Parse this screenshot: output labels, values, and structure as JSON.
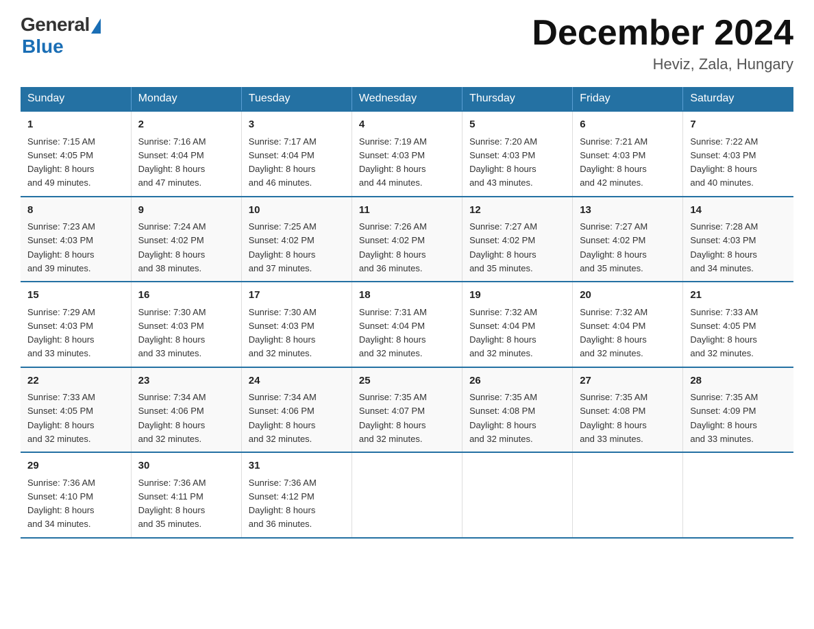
{
  "logo": {
    "general": "General",
    "blue": "Blue",
    "subtitle": "Blue"
  },
  "title": "December 2024",
  "location": "Heviz, Zala, Hungary",
  "days_of_week": [
    "Sunday",
    "Monday",
    "Tuesday",
    "Wednesday",
    "Thursday",
    "Friday",
    "Saturday"
  ],
  "weeks": [
    [
      {
        "day": "1",
        "sunrise": "7:15 AM",
        "sunset": "4:05 PM",
        "daylight": "8 hours and 49 minutes."
      },
      {
        "day": "2",
        "sunrise": "7:16 AM",
        "sunset": "4:04 PM",
        "daylight": "8 hours and 47 minutes."
      },
      {
        "day": "3",
        "sunrise": "7:17 AM",
        "sunset": "4:04 PM",
        "daylight": "8 hours and 46 minutes."
      },
      {
        "day": "4",
        "sunrise": "7:19 AM",
        "sunset": "4:03 PM",
        "daylight": "8 hours and 44 minutes."
      },
      {
        "day": "5",
        "sunrise": "7:20 AM",
        "sunset": "4:03 PM",
        "daylight": "8 hours and 43 minutes."
      },
      {
        "day": "6",
        "sunrise": "7:21 AM",
        "sunset": "4:03 PM",
        "daylight": "8 hours and 42 minutes."
      },
      {
        "day": "7",
        "sunrise": "7:22 AM",
        "sunset": "4:03 PM",
        "daylight": "8 hours and 40 minutes."
      }
    ],
    [
      {
        "day": "8",
        "sunrise": "7:23 AM",
        "sunset": "4:03 PM",
        "daylight": "8 hours and 39 minutes."
      },
      {
        "day": "9",
        "sunrise": "7:24 AM",
        "sunset": "4:02 PM",
        "daylight": "8 hours and 38 minutes."
      },
      {
        "day": "10",
        "sunrise": "7:25 AM",
        "sunset": "4:02 PM",
        "daylight": "8 hours and 37 minutes."
      },
      {
        "day": "11",
        "sunrise": "7:26 AM",
        "sunset": "4:02 PM",
        "daylight": "8 hours and 36 minutes."
      },
      {
        "day": "12",
        "sunrise": "7:27 AM",
        "sunset": "4:02 PM",
        "daylight": "8 hours and 35 minutes."
      },
      {
        "day": "13",
        "sunrise": "7:27 AM",
        "sunset": "4:02 PM",
        "daylight": "8 hours and 35 minutes."
      },
      {
        "day": "14",
        "sunrise": "7:28 AM",
        "sunset": "4:03 PM",
        "daylight": "8 hours and 34 minutes."
      }
    ],
    [
      {
        "day": "15",
        "sunrise": "7:29 AM",
        "sunset": "4:03 PM",
        "daylight": "8 hours and 33 minutes."
      },
      {
        "day": "16",
        "sunrise": "7:30 AM",
        "sunset": "4:03 PM",
        "daylight": "8 hours and 33 minutes."
      },
      {
        "day": "17",
        "sunrise": "7:30 AM",
        "sunset": "4:03 PM",
        "daylight": "8 hours and 32 minutes."
      },
      {
        "day": "18",
        "sunrise": "7:31 AM",
        "sunset": "4:04 PM",
        "daylight": "8 hours and 32 minutes."
      },
      {
        "day": "19",
        "sunrise": "7:32 AM",
        "sunset": "4:04 PM",
        "daylight": "8 hours and 32 minutes."
      },
      {
        "day": "20",
        "sunrise": "7:32 AM",
        "sunset": "4:04 PM",
        "daylight": "8 hours and 32 minutes."
      },
      {
        "day": "21",
        "sunrise": "7:33 AM",
        "sunset": "4:05 PM",
        "daylight": "8 hours and 32 minutes."
      }
    ],
    [
      {
        "day": "22",
        "sunrise": "7:33 AM",
        "sunset": "4:05 PM",
        "daylight": "8 hours and 32 minutes."
      },
      {
        "day": "23",
        "sunrise": "7:34 AM",
        "sunset": "4:06 PM",
        "daylight": "8 hours and 32 minutes."
      },
      {
        "day": "24",
        "sunrise": "7:34 AM",
        "sunset": "4:06 PM",
        "daylight": "8 hours and 32 minutes."
      },
      {
        "day": "25",
        "sunrise": "7:35 AM",
        "sunset": "4:07 PM",
        "daylight": "8 hours and 32 minutes."
      },
      {
        "day": "26",
        "sunrise": "7:35 AM",
        "sunset": "4:08 PM",
        "daylight": "8 hours and 32 minutes."
      },
      {
        "day": "27",
        "sunrise": "7:35 AM",
        "sunset": "4:08 PM",
        "daylight": "8 hours and 33 minutes."
      },
      {
        "day": "28",
        "sunrise": "7:35 AM",
        "sunset": "4:09 PM",
        "daylight": "8 hours and 33 minutes."
      }
    ],
    [
      {
        "day": "29",
        "sunrise": "7:36 AM",
        "sunset": "4:10 PM",
        "daylight": "8 hours and 34 minutes."
      },
      {
        "day": "30",
        "sunrise": "7:36 AM",
        "sunset": "4:11 PM",
        "daylight": "8 hours and 35 minutes."
      },
      {
        "day": "31",
        "sunrise": "7:36 AM",
        "sunset": "4:12 PM",
        "daylight": "8 hours and 36 minutes."
      },
      null,
      null,
      null,
      null
    ]
  ],
  "labels": {
    "sunrise": "Sunrise:",
    "sunset": "Sunset:",
    "daylight": "Daylight:"
  }
}
